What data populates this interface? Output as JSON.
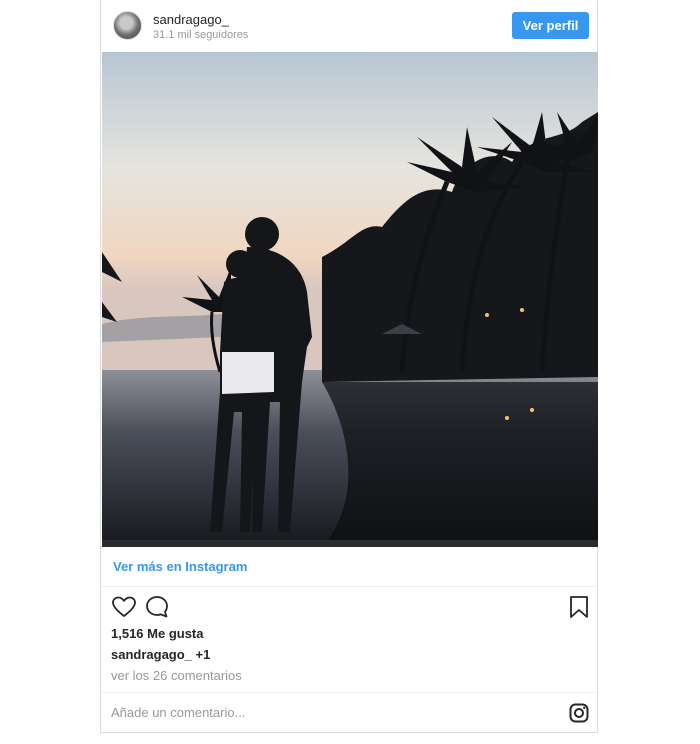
{
  "post": {
    "username": "sandragago_",
    "followers": "31.1 mil seguidores",
    "view_profile_label": "Ver perfil",
    "see_more_label": "Ver más en Instagram",
    "likes": "1,516 Me gusta",
    "caption_user": "sandragago_",
    "caption_text": "+1",
    "comments_link": "ver los 26 comentarios",
    "add_comment_placeholder": "Añade un comentario..."
  },
  "colors": {
    "accent": "#3897f0",
    "muted_text": "#999999",
    "border": "#dbdbdb"
  },
  "icons": [
    "heart-icon",
    "comment-icon",
    "bookmark-icon",
    "instagram-logo-icon"
  ]
}
